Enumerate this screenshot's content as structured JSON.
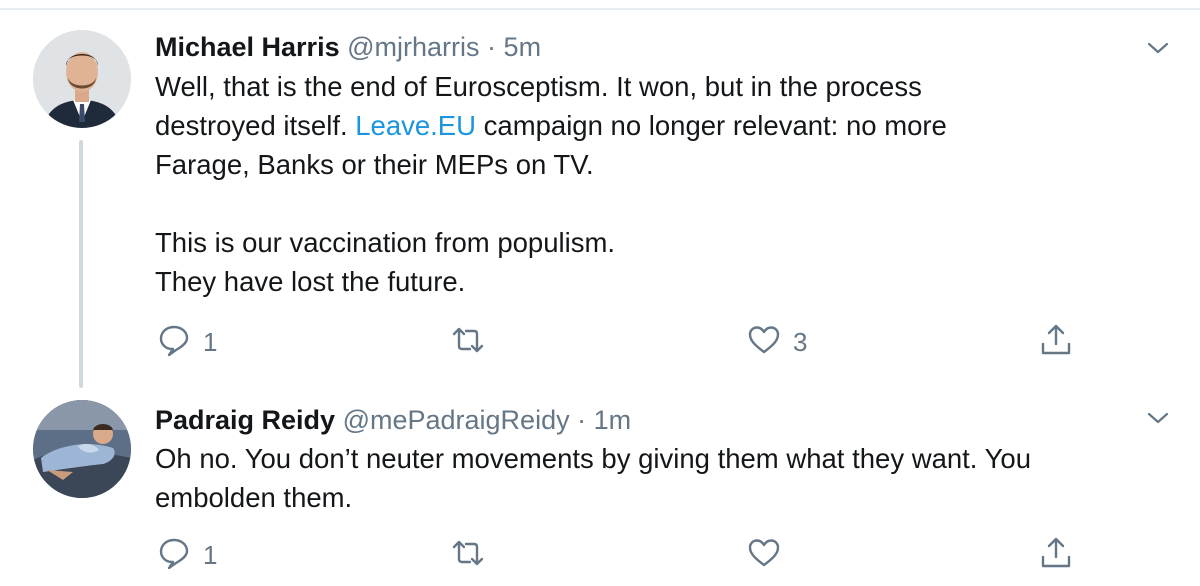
{
  "tweets": [
    {
      "name": "Michael Harris",
      "handle": "@mjrharris",
      "separator": "·",
      "time": "5m",
      "lines": [
        {
          "before": "Well, that is the end of Eurosceptism. It won, but in the process"
        },
        {
          "before": "destroyed itself. ",
          "link": "Leave.EU",
          "after": " campaign no longer relevant: no more"
        },
        {
          "before": "Farage, Banks or their MEPs on TV."
        },
        {
          "before": "This is our vaccination from populism."
        },
        {
          "before": "They have lost the future."
        }
      ],
      "reply_count": "1",
      "retweet_count": "",
      "like_count": "3"
    },
    {
      "name": "Padraig Reidy",
      "handle": "@mePadraigReidy",
      "separator": "·",
      "time": "1m",
      "lines": [
        {
          "before": "Oh no. You don’t neuter movements by giving them what they want. You"
        },
        {
          "before": "embolden them."
        }
      ],
      "reply_count": "1",
      "retweet_count": "",
      "like_count": ""
    }
  ],
  "icons": {
    "reply": "reply-icon",
    "retweet": "retweet-icon",
    "like": "heart-icon",
    "share": "share-icon",
    "menu": "chevron-down-icon"
  },
  "colors": {
    "text": "#14171a",
    "secondary": "#657786",
    "link": "#1b95e0",
    "thread_line": "#cfd9de"
  }
}
